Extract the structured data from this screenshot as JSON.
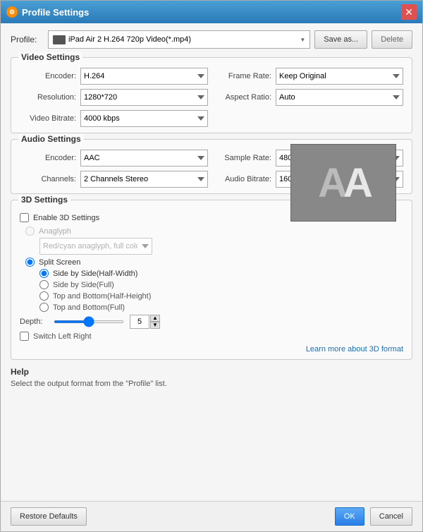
{
  "window": {
    "title": "Profile Settings",
    "icon": "⚙"
  },
  "profile": {
    "label": "Profile:",
    "value": "iPad Air 2 H.264 720p Video(*.mp4)",
    "save_as_label": "Save as...",
    "delete_label": "Delete"
  },
  "video_settings": {
    "section_title": "Video Settings",
    "encoder_label": "Encoder:",
    "encoder_value": "H.264",
    "frame_rate_label": "Frame Rate:",
    "frame_rate_value": "Keep Original",
    "resolution_label": "Resolution:",
    "resolution_value": "1280*720",
    "aspect_ratio_label": "Aspect Ratio:",
    "aspect_ratio_value": "Auto",
    "video_bitrate_label": "Video Bitrate:",
    "video_bitrate_value": "4000 kbps"
  },
  "audio_settings": {
    "section_title": "Audio Settings",
    "encoder_label": "Encoder:",
    "encoder_value": "AAC",
    "sample_rate_label": "Sample Rate:",
    "sample_rate_value": "48000 Hz",
    "channels_label": "Channels:",
    "channels_value": "2 Channels Stereo",
    "audio_bitrate_label": "Audio Bitrate:",
    "audio_bitrate_value": "160 kbps"
  },
  "settings_3d": {
    "section_title": "3D Settings",
    "enable_label": "Enable 3D Settings",
    "anaglyph_label": "Anaglyph",
    "anaglyph_value": "Red/cyan anaglyph, full color",
    "split_screen_label": "Split Screen",
    "side_by_side_half_label": "Side by Side(Half-Width)",
    "side_by_side_full_label": "Side by Side(Full)",
    "top_bottom_half_label": "Top and Bottom(Half-Height)",
    "top_bottom_full_label": "Top and Bottom(Full)",
    "depth_label": "Depth:",
    "depth_value": "5",
    "switch_lr_label": "Switch Left Right",
    "learn_more_link": "Learn more about 3D format",
    "preview_text": "AA"
  },
  "help": {
    "title": "Help",
    "text": "Select the output format from the \"Profile\" list."
  },
  "footer": {
    "restore_defaults_label": "Restore Defaults",
    "ok_label": "OK",
    "cancel_label": "Cancel"
  }
}
